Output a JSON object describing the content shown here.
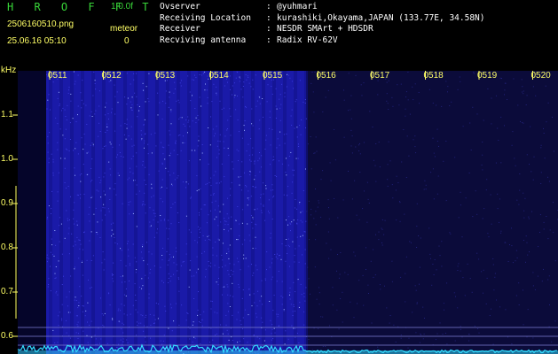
{
  "header": {
    "logo": "H R O F F T",
    "version": "1.0.0f",
    "filename": "2506160510.png",
    "meteor_label": "meteor",
    "timestamp": "25.06.16 05:10",
    "meteor_count": "0"
  },
  "info": [
    {
      "key": "Ovserver",
      "sep": ":",
      "value": "@yuhmari"
    },
    {
      "key": "Receiving Location",
      "sep": ":",
      "value": "kurashiki,Okayama,JAPAN (133.77E, 34.58N)"
    },
    {
      "key": "Receiver",
      "sep": ":",
      "value": "NESDR SMArt + HDSDR"
    },
    {
      "key": "Recviving antenna",
      "sep": ":",
      "value": "Radix RV-62V"
    }
  ],
  "axis": {
    "unit": "kHz",
    "x_ticks": [
      "0511",
      "0512",
      "0513",
      "0514",
      "0515",
      "0516",
      "0517",
      "0518",
      "0519",
      "0520"
    ],
    "y_ticks": [
      "1.1",
      "1.0",
      "0.9",
      "0.8",
      "0.7",
      "0.6"
    ]
  },
  "colors": {
    "text_green": "#39d639",
    "text_yellow": "#ffff66",
    "noise_bright": "#1a1aa8",
    "noise_dim": "#0d0d4a",
    "trace": "#33ddff"
  }
}
